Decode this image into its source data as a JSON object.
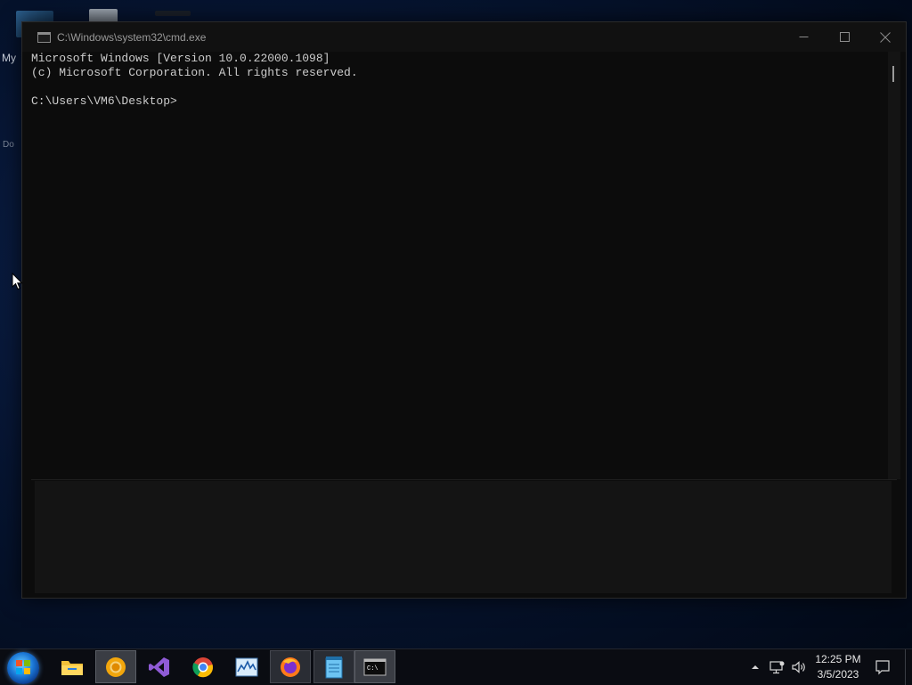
{
  "desktop": {
    "partial_label": "My",
    "partial_label_2": "Do"
  },
  "window": {
    "title": "C:\\Windows\\system32\\cmd.exe",
    "controls": {
      "minimize": "minimize",
      "maximize": "maximize",
      "close": "close"
    }
  },
  "console": {
    "lines": [
      "Microsoft Windows [Version 10.0.22000.1098]",
      "(c) Microsoft Corporation. All rights reserved.",
      "",
      "C:\\Users\\VM6\\Desktop>"
    ]
  },
  "taskbar": {
    "apps": [
      {
        "name": "file-explorer-icon"
      },
      {
        "name": "chrome-canary-icon"
      },
      {
        "name": "visual-studio-icon"
      },
      {
        "name": "chrome-icon"
      },
      {
        "name": "resource-monitor-icon"
      },
      {
        "name": "firefox-icon"
      },
      {
        "name": "notepad-icon"
      },
      {
        "name": "cmd-icon"
      }
    ],
    "tray": {
      "icons": [
        "chevron-up-icon",
        "network-icon",
        "volume-icon",
        "notification-icon"
      ]
    },
    "clock": {
      "time": "12:25 PM",
      "date": "3/5/2023"
    }
  },
  "colors": {
    "console_bg": "#0c0c0c",
    "console_text": "#cccccc",
    "taskbar_bg": "#0a0c12"
  }
}
